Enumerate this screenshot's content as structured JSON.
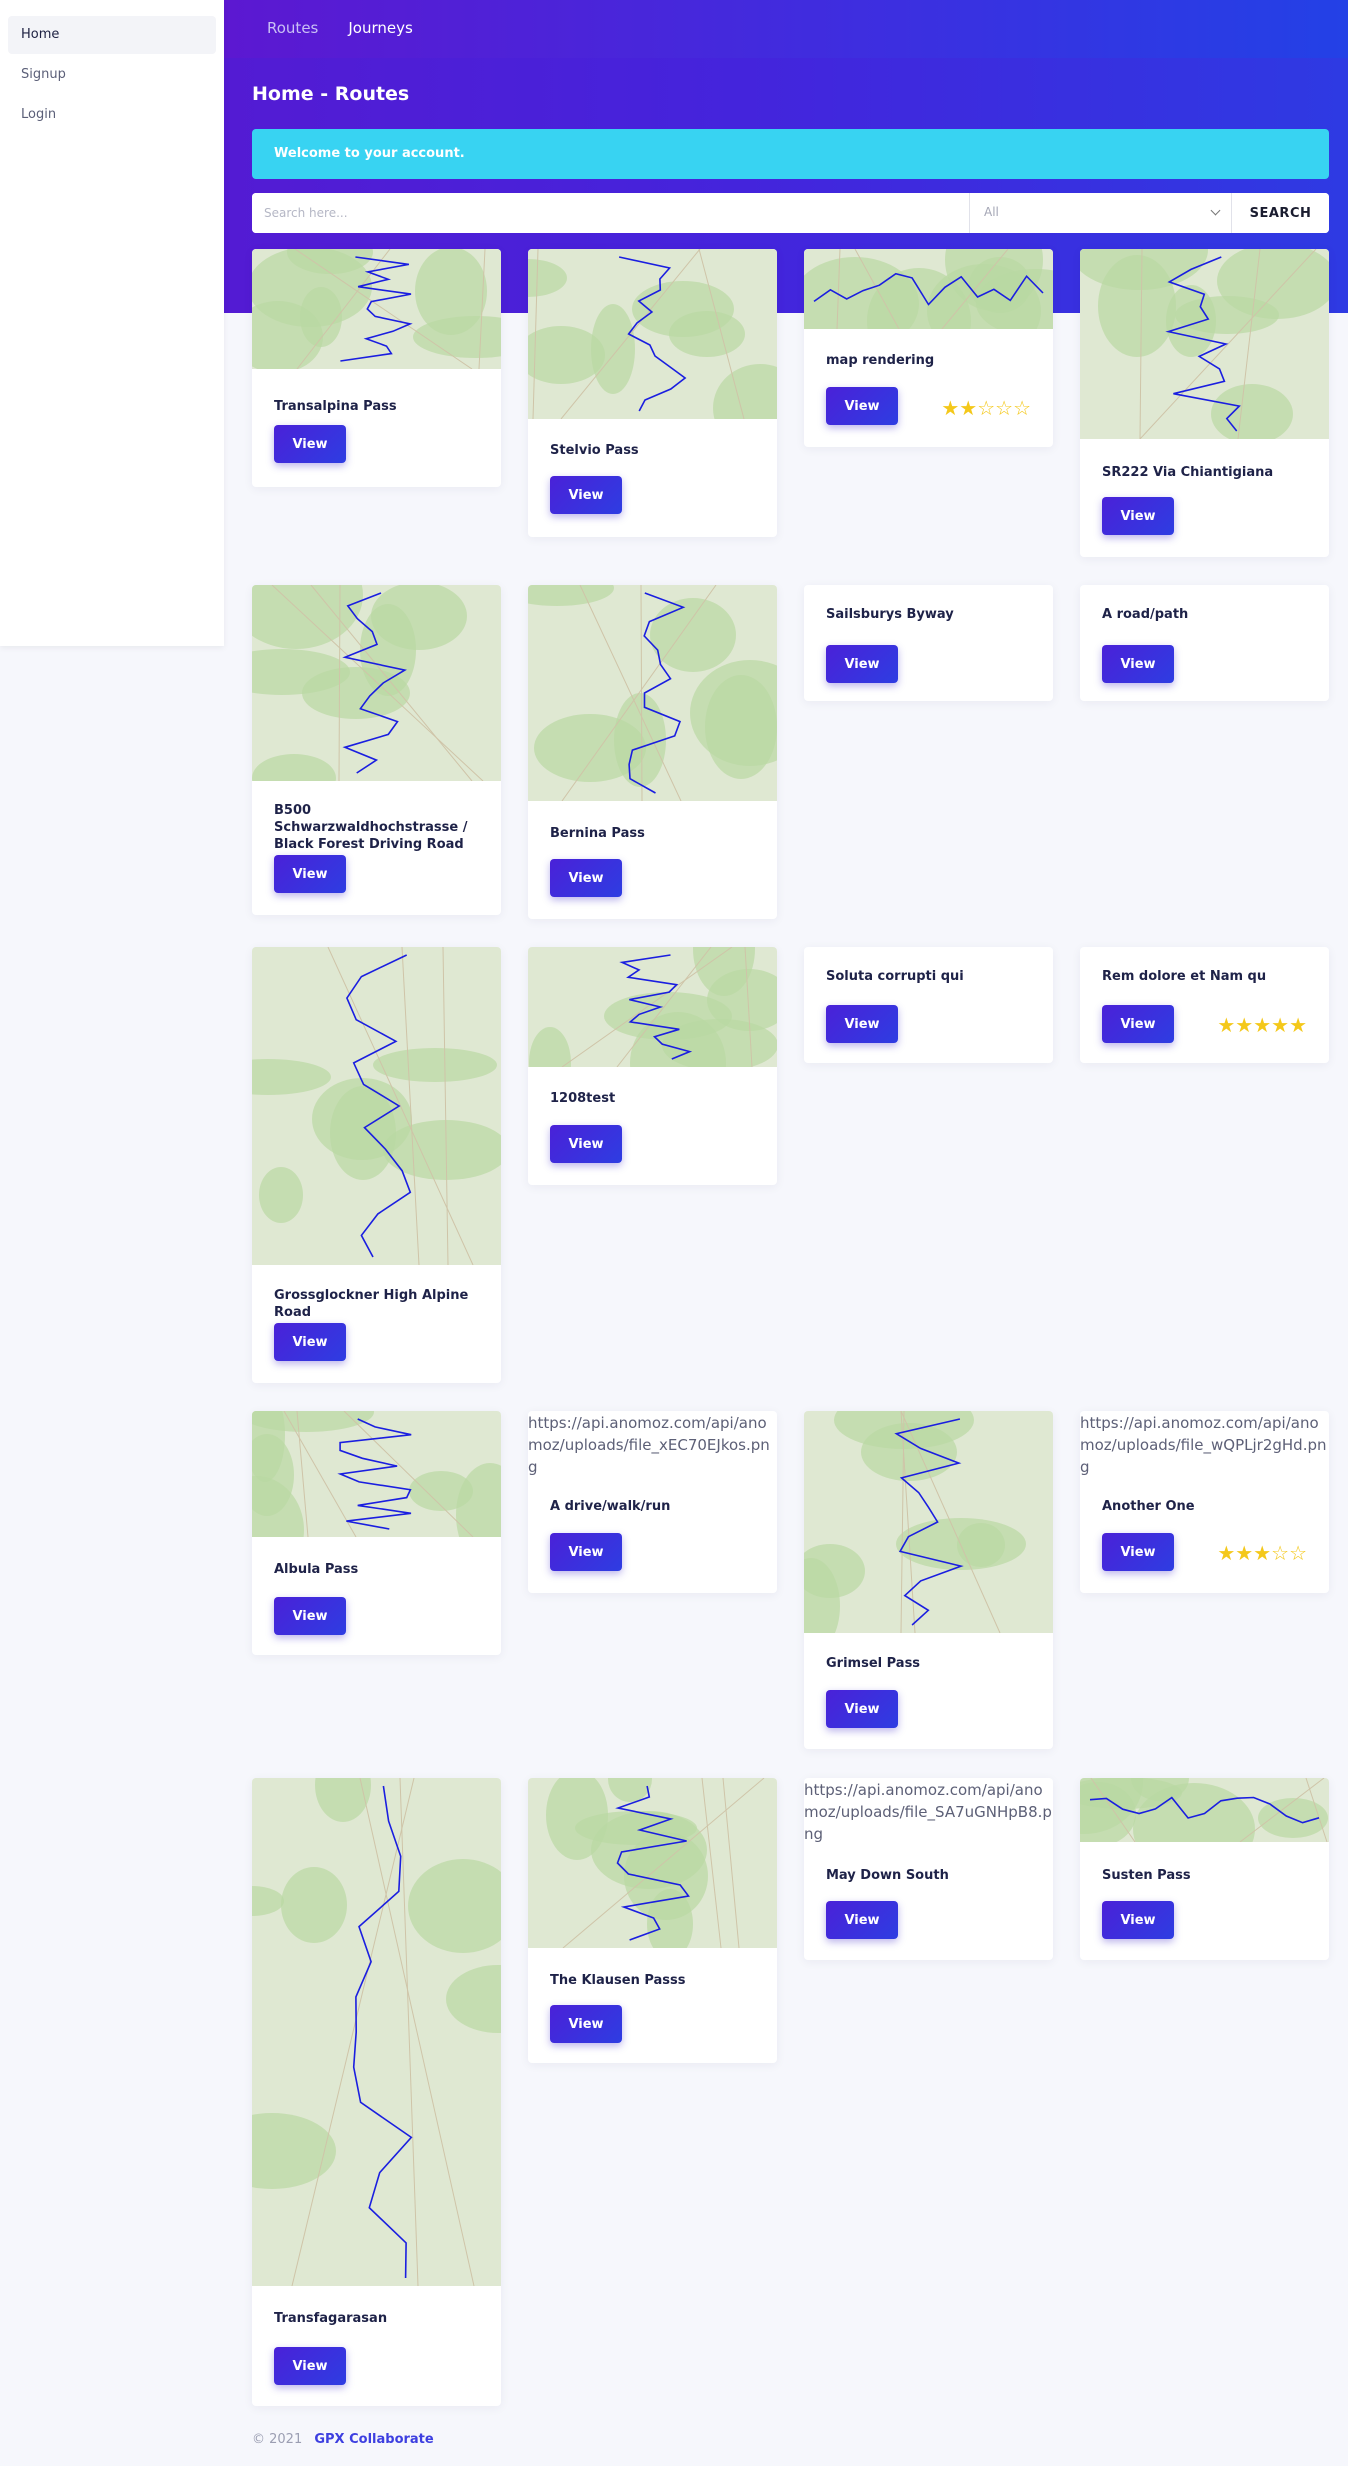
{
  "colors": {
    "accent": "#4424dc",
    "alert": "#38d3f2",
    "star": "#f4c81a"
  },
  "topnav": {
    "items": [
      {
        "label": "Routes"
      },
      {
        "label": "Journeys"
      }
    ]
  },
  "sidebar": {
    "items": [
      {
        "label": "Home"
      },
      {
        "label": "Signup"
      },
      {
        "label": "Login"
      }
    ]
  },
  "header": {
    "title": "Home - Routes"
  },
  "alert": {
    "text": "Welcome to your account."
  },
  "search": {
    "placeholder": "Search here...",
    "filter_value": "All",
    "button_label": "SEARCH"
  },
  "view_label": "View",
  "cards": [
    {
      "title": "Transalpina Pass"
    },
    {
      "title": "Stelvio Pass"
    },
    {
      "title": "map rendering",
      "rating": 2,
      "rating_max": 5
    },
    {
      "title": "SR222 Via Chiantigiana"
    },
    {
      "title": "B500 Schwarzwaldhochstrasse / Black Forest Driving Road"
    },
    {
      "title": "Bernina Pass"
    },
    {
      "title": "Sailsburys Byway"
    },
    {
      "title": "A road/path"
    },
    {
      "title": "Grossglockner High Alpine Road"
    },
    {
      "title": "1208test"
    },
    {
      "title": "Soluta corrupti qui"
    },
    {
      "title": "Rem dolore et Nam qu",
      "rating": 5,
      "rating_max": 5
    },
    {
      "title": "Albula Pass"
    },
    {
      "title": "A drive/walk/run",
      "image_alt": "https://api.anomoz.com/api/anomoz/uploads/file_xEC70EJkos.png"
    },
    {
      "title": "Grimsel Pass"
    },
    {
      "title": "Another One",
      "image_alt": "https://api.anomoz.com/api/anomoz/uploads/file_wQPLjr2gHd.png",
      "rating": 3,
      "rating_max": 5
    },
    {
      "title": "Transfagarasan"
    },
    {
      "title": "The Klausen Passs"
    },
    {
      "title": "May Down South",
      "image_alt": "https://api.anomoz.com/api/anomoz/uploads/file_SA7uGNHpB8.png"
    },
    {
      "title": "Susten Pass"
    }
  ],
  "footer": {
    "copyright": "© 2021",
    "brand": "GPX Collaborate"
  }
}
